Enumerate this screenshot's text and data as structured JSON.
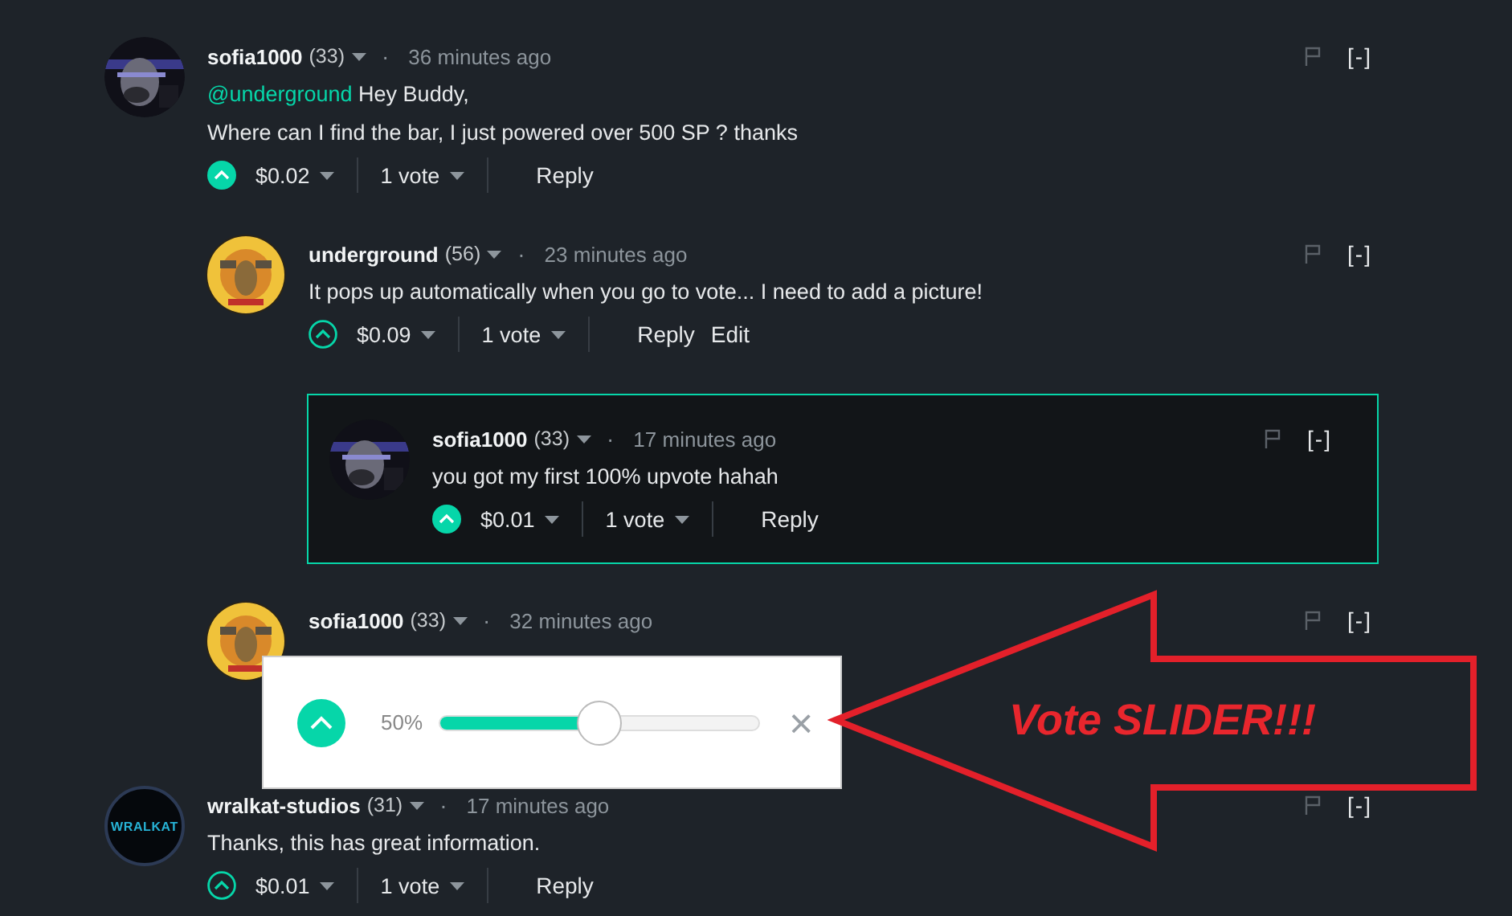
{
  "comments": [
    {
      "author": "sofia1000",
      "reputation": "(33)",
      "separator": "·",
      "time": "36 minutes ago",
      "avatar": {
        "kind": "picture"
      },
      "mention": "@underground",
      "lines": [
        "Hey Buddy,",
        "Where can I find the bar, I just powered over 500 SP ? thanks"
      ],
      "upvoted": true,
      "payout": "$0.02",
      "votes": "1 vote",
      "actions": [
        "Reply"
      ],
      "toggle": "[-]",
      "children": [
        {
          "author": "underground",
          "reputation": "(56)",
          "separator": "·",
          "time": "23 minutes ago",
          "avatar": {
            "kind": "picture"
          },
          "lines": [
            "It pops up automatically when you go to vote... I need to add a picture!"
          ],
          "upvoted": false,
          "payout": "$0.09",
          "votes": "1 vote",
          "actions": [
            "Reply",
            "Edit"
          ],
          "toggle": "[-]",
          "children": [
            {
              "author": "sofia1000",
              "reputation": "(33)",
              "separator": "·",
              "time": "17 minutes ago",
              "avatar": {
                "kind": "picture"
              },
              "highlighted": true,
              "lines": [
                "you got my first 100% upvote hahah"
              ],
              "upvoted": true,
              "payout": "$0.01",
              "votes": "1 vote",
              "actions": [
                "Reply"
              ],
              "toggle": "[-]"
            }
          ]
        },
        {
          "author": "sofia1000",
          "reputation": "(33)",
          "separator": "·",
          "time": "32 minutes ago",
          "avatar": {
            "kind": "picture"
          },
          "toggle": "[-]",
          "vote_popup": {
            "percent": "50%",
            "level": 0.5,
            "close": "×"
          }
        }
      ]
    },
    {
      "author": "wralkat-studios",
      "reputation": "(31)",
      "separator": "·",
      "time": "17 minutes ago",
      "avatar": {
        "kind": "logo",
        "text": "WRALKAT"
      },
      "lines": [
        "Thanks, this has great information."
      ],
      "upvoted": false,
      "payout": "$0.01",
      "votes": "1 vote",
      "actions": [
        "Reply"
      ],
      "toggle": "[-]"
    }
  ],
  "annotation": {
    "text": "Vote SLIDER!!!"
  }
}
